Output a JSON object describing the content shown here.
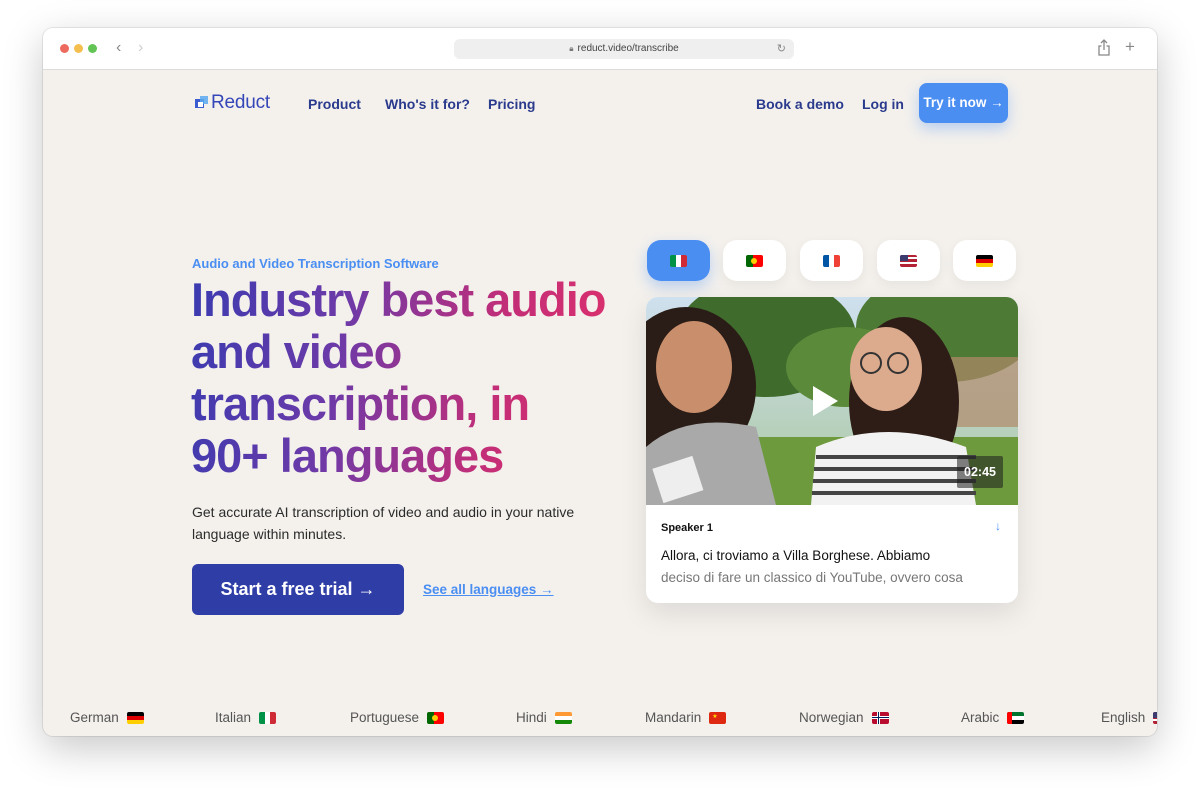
{
  "browser": {
    "url": "reduct.video/transcribe"
  },
  "nav": {
    "logo_text": "Reduct",
    "links": [
      "Product",
      "Who's it for?",
      "Pricing"
    ],
    "book_demo": "Book a demo",
    "login": "Log in",
    "try_now": "Try it now →"
  },
  "hero": {
    "eyebrow": "Audio and Video Transcription Software",
    "headline": "Industry best audio and video transcription, in 90+ languages",
    "subtext": "Get accurate AI transcription of video and audio in your native language within minutes.",
    "cta": "Start a free trial →",
    "see_all": "See all languages →"
  },
  "language_tabs": [
    {
      "flag": "italy-flag",
      "active": true
    },
    {
      "flag": "portugal-flag",
      "active": false
    },
    {
      "flag": "france-flag",
      "active": false
    },
    {
      "flag": "usa-flag",
      "active": false
    },
    {
      "flag": "germany-flag",
      "active": false
    }
  ],
  "video_card": {
    "duration": "02:45",
    "speaker": "Speaker 1",
    "line1": "Allora, ci troviamo a Villa Borghese. Abbiamo",
    "line2": "deciso di fare un classico di YouTube, ovvero cosa"
  },
  "languages": [
    "German",
    "Italian",
    "Portuguese",
    "Hindi",
    "Mandarin",
    "Norwegian",
    "Arabic",
    "English"
  ],
  "colors": {
    "accent_blue": "#4a8ef2",
    "navy": "#2f3da6",
    "background": "#f4f1ed"
  }
}
